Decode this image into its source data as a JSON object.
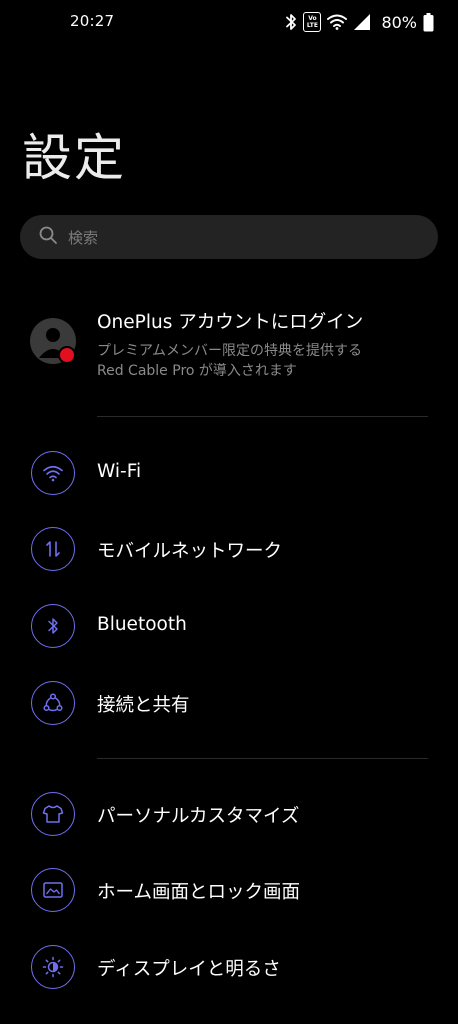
{
  "status_bar": {
    "time": "20:27",
    "volte_top": "Vo",
    "volte_bottom": "LTE",
    "battery": "80%",
    "icons": [
      "bluetooth-icon",
      "volte-icon",
      "wifi-icon",
      "cell-signal-icon",
      "battery-icon"
    ]
  },
  "page": {
    "title": "設定"
  },
  "search": {
    "placeholder": "検索"
  },
  "account": {
    "title": "OnePlus アカウントにログイン",
    "subtitle_line1": "プレミアムメンバー限定の特典を提供する",
    "subtitle_line2": "Red Cable Pro が導入されます",
    "notification_color": "#e01020"
  },
  "menu": {
    "accent_color": "#6f6ff0",
    "items": [
      {
        "label": "Wi-Fi",
        "icon": "wifi-icon"
      },
      {
        "label": "モバイルネットワーク",
        "icon": "mobile-data-icon"
      },
      {
        "label": "Bluetooth",
        "icon": "bluetooth-icon"
      },
      {
        "label": "接続と共有",
        "icon": "share-connection-icon"
      },
      {
        "label": "パーソナルカスタマイズ",
        "icon": "tshirt-icon"
      },
      {
        "label": "ホーム画面とロック画面",
        "icon": "wallpaper-icon"
      },
      {
        "label": "ディスプレイと明るさ",
        "icon": "brightness-icon"
      }
    ]
  }
}
